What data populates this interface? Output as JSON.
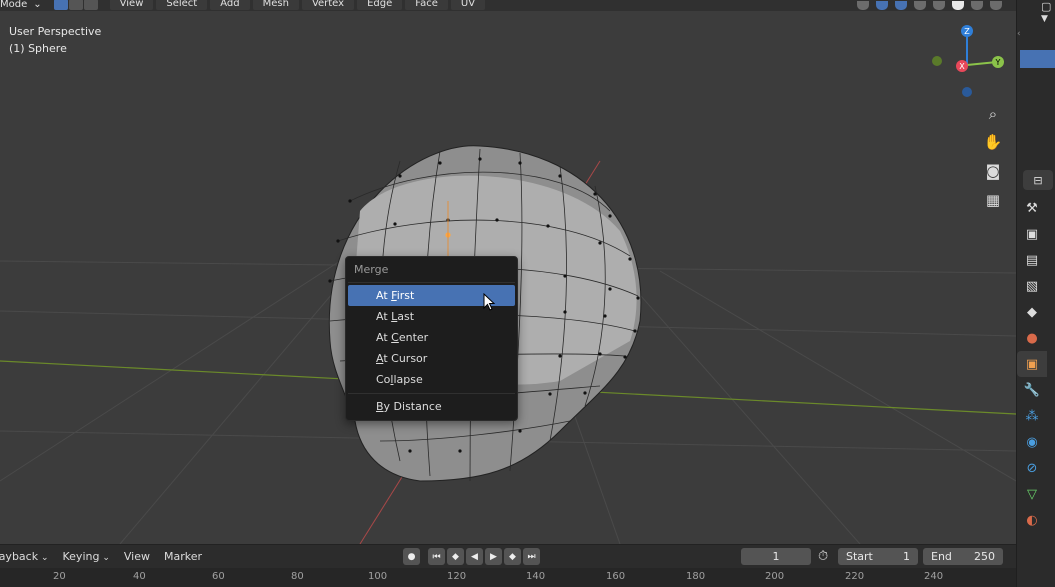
{
  "header": {
    "mode_label": "Mode",
    "menus": [
      "View",
      "Select",
      "Add",
      "Mesh",
      "Vertex",
      "Edge",
      "Face",
      "UV"
    ]
  },
  "viewport": {
    "perspective": "User Perspective",
    "object": "(1) Sphere",
    "gizmo": {
      "x": "X",
      "y": "Y",
      "z": "Z"
    }
  },
  "merge_menu": {
    "title": "Merge",
    "items": [
      {
        "label": "At First",
        "mnemonic": "F",
        "rest": "irst",
        "prefix": "At "
      },
      {
        "label": "At Last",
        "prefix": "At ",
        "mnemonic": "L",
        "rest": "ast"
      },
      {
        "label": "At Center",
        "prefix": "At ",
        "mnemonic": "C",
        "rest": "enter"
      },
      {
        "label": "At Cursor",
        "prefix": "",
        "mnemonic": "A",
        "rest": "t Cursor"
      },
      {
        "label": "Collapse",
        "prefix": "Co",
        "mnemonic": "l",
        "rest": "lapse"
      },
      {
        "label": "By Distance",
        "prefix": "",
        "mnemonic": "B",
        "rest": "y Distance"
      }
    ],
    "active_index": 0
  },
  "timeline": {
    "playback": "Playback",
    "keying": "Keying",
    "view": "View",
    "marker": "Marker",
    "current_frame": "1",
    "start_label": "Start",
    "start_value": "1",
    "end_label": "End",
    "end_value": "250",
    "ruler": [
      "20",
      "40",
      "60",
      "80",
      "100",
      "120",
      "140",
      "160",
      "180",
      "200",
      "220",
      "240"
    ]
  },
  "colors": {
    "accent": "#4772b3",
    "x_axis": "#e8485a",
    "y_axis": "#8bc34a",
    "z_axis": "#2f7fd9"
  }
}
